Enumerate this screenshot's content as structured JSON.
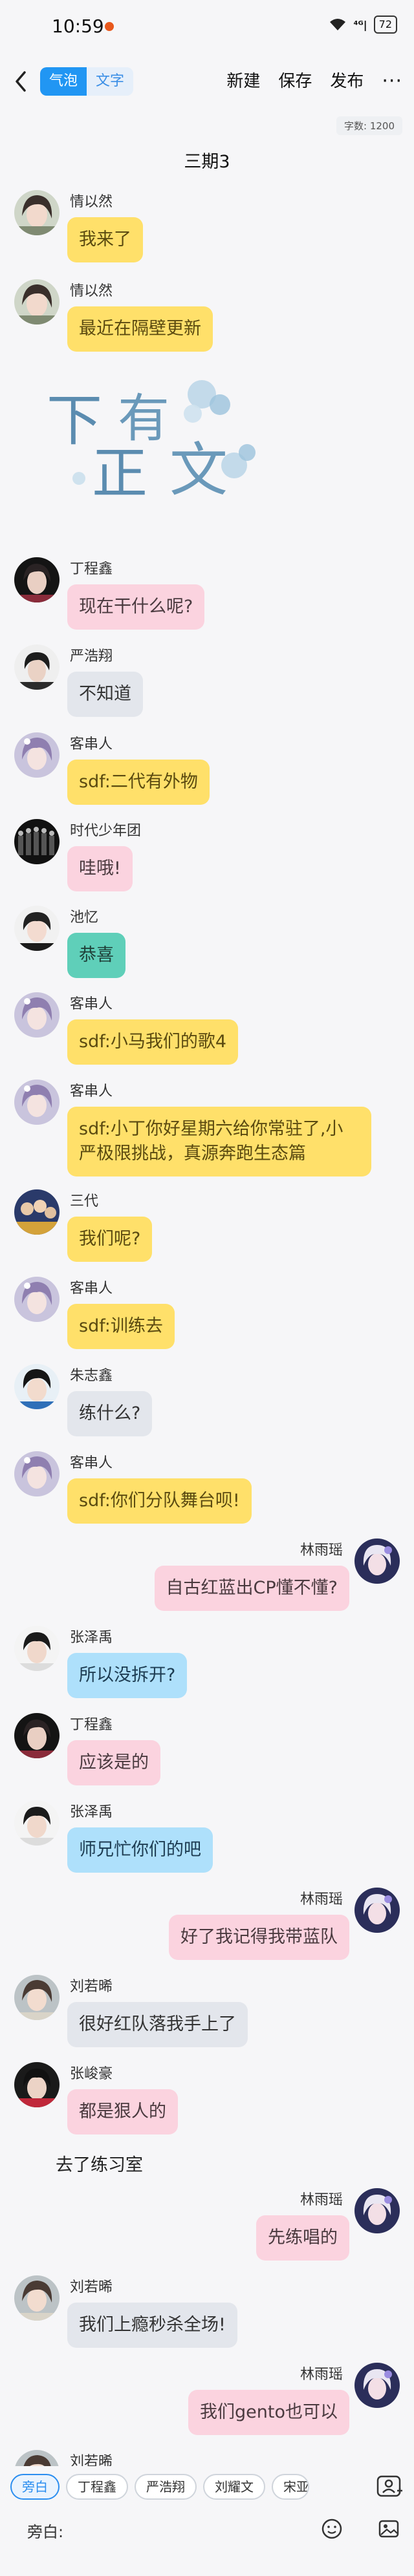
{
  "status_bar": {
    "time": "10:59",
    "signal": "⁴ᴳ|",
    "battery": "72"
  },
  "topbar": {
    "mode_bubble": "气泡",
    "mode_text": "文字",
    "new_label": "新建",
    "save_label": "保存",
    "publish_label": "发布",
    "more_label": "···"
  },
  "wordcount": "字数: 1200",
  "doc_title": "三期3",
  "logo_text": [
    "下",
    "有",
    "正",
    "文"
  ],
  "narration_text": "去了练习室",
  "messages": [
    {
      "name": "情以然",
      "text": "我来了"
    },
    {
      "name": "情以然",
      "text": "最近在隔壁更新"
    },
    {
      "name": "丁程鑫",
      "text": "现在干什么呢?"
    },
    {
      "name": "严浩翔",
      "text": "不知道"
    },
    {
      "name": "客串人",
      "text": "sdf:二代有外物"
    },
    {
      "name": "时代少年团",
      "text": "哇哦!"
    },
    {
      "name": "池忆",
      "text": "恭喜"
    },
    {
      "name": "客串人",
      "text": "sdf:小马我们的歌4"
    },
    {
      "name": "客串人",
      "text": "sdf:小丁你好星期六给你常驻了,小严极限挑战，真源奔跑生态篇"
    },
    {
      "name": "三代",
      "text": "我们呢?"
    },
    {
      "name": "客串人",
      "text": "sdf:训练去"
    },
    {
      "name": "朱志鑫",
      "text": "练什么?"
    },
    {
      "name": "客串人",
      "text": "sdf:你们分队舞台呗!"
    },
    {
      "name": "林雨瑶",
      "text": "自古红蓝出CP懂不懂?"
    },
    {
      "name": "张泽禹",
      "text": "所以没拆开?"
    },
    {
      "name": "丁程鑫",
      "text": "应该是的"
    },
    {
      "name": "张泽禹",
      "text": "师兄忙你们的吧"
    },
    {
      "name": "林雨瑶",
      "text": "好了我记得我带蓝队"
    },
    {
      "name": "刘若晞",
      "text": "很好红队落我手上了"
    },
    {
      "name": "张峻豪",
      "text": "都是狠人的"
    },
    {
      "name": "林雨瑶",
      "text": "先练唱的"
    },
    {
      "name": "刘若晞",
      "text": "我们上瘾秒杀全场!"
    },
    {
      "name": "林雨瑶",
      "text": "我们gento也可以"
    },
    {
      "name": "刘若晞",
      "text": ""
    }
  ],
  "role_chips": [
    "旁白",
    "丁程鑫",
    "严浩翔",
    "刘耀文",
    "宋亚"
  ],
  "input": {
    "label": "旁白:"
  },
  "colors": {
    "accent": "#2196f3",
    "bubble_yellow": "#ffe06a",
    "bubble_pink": "#fbd3df",
    "bubble_gray": "#e3e6ec",
    "bubble_teal": "#5fcfb9",
    "bubble_blue": "#aee0fb"
  }
}
